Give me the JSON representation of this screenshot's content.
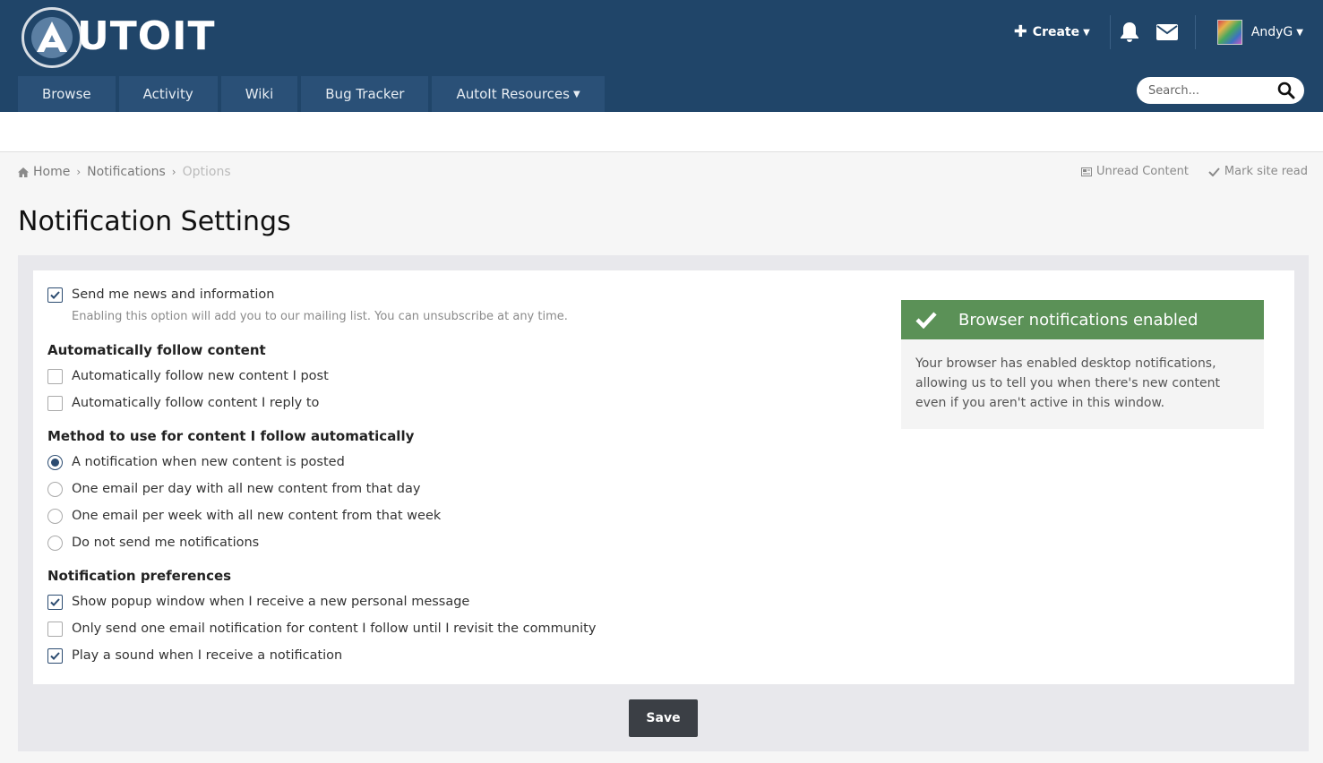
{
  "header": {
    "logo_text": "UTOIT",
    "create_label": "Create",
    "user_name": "AndyG",
    "search_placeholder": "Search..."
  },
  "nav": [
    {
      "label": "Browse"
    },
    {
      "label": "Activity"
    },
    {
      "label": "Wiki"
    },
    {
      "label": "Bug Tracker"
    },
    {
      "label": "AutoIt Resources"
    }
  ],
  "breadcrumb": {
    "home": "Home",
    "notifications": "Notifications",
    "current": "Options",
    "unread": "Unread Content",
    "mark_read": "Mark site read"
  },
  "page": {
    "title": "Notification Settings"
  },
  "settings": {
    "news": {
      "label": "Send me news and information",
      "checked": true,
      "description": "Enabling this option will add you to our mailing list. You can unsubscribe at any time."
    },
    "follow_heading": "Automatically follow content",
    "follow_new": {
      "label": "Automatically follow new content I post",
      "checked": false
    },
    "follow_reply": {
      "label": "Automatically follow content I reply to",
      "checked": false
    },
    "method_heading": "Method to use for content I follow automatically",
    "methods": [
      {
        "label": "A notification when new content is posted",
        "selected": true
      },
      {
        "label": "One email per day with all new content from that day",
        "selected": false
      },
      {
        "label": "One email per week with all new content from that week",
        "selected": false
      },
      {
        "label": "Do not send me notifications",
        "selected": false
      }
    ],
    "prefs_heading": "Notification preferences",
    "prefs": [
      {
        "label": "Show popup window when I receive a new personal message",
        "checked": true
      },
      {
        "label": "Only send one email notification for content I follow until I revisit the community",
        "checked": false
      },
      {
        "label": "Play a sound when I receive a notification",
        "checked": true
      }
    ]
  },
  "browser_notice": {
    "title": "Browser notifications enabled",
    "body": "Your browser has enabled desktop notifications, allowing us to tell you when there's new content even if you aren't active in this window."
  },
  "save_label": "Save",
  "colors": {
    "header_bg": "#204569",
    "nav_bg": "#2a5077",
    "success": "#5b9157",
    "button": "#3b3f45"
  }
}
